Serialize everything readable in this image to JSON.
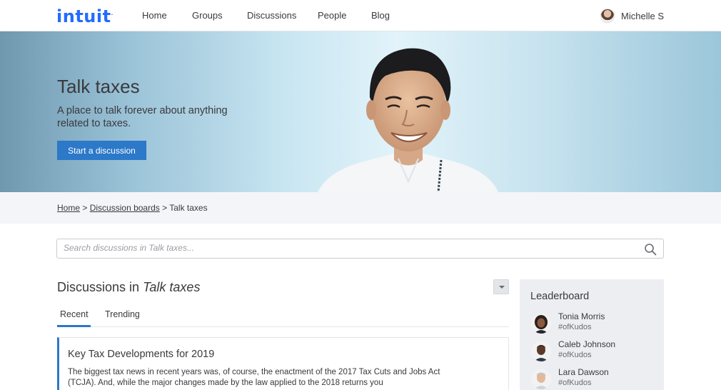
{
  "nav": {
    "logo": "intuit",
    "logo_mark": ".",
    "links": [
      "Home",
      "Groups",
      "Discussions",
      "People",
      "Blog"
    ],
    "user_name": "Michelle S"
  },
  "hero": {
    "title": "Talk taxes",
    "subtitle": "A place to talk forever about anything related to taxes.",
    "cta": "Start a discussion"
  },
  "breadcrumb": {
    "items": [
      "Home",
      "Discussion boards"
    ],
    "separator": ">",
    "current": "Talk taxes"
  },
  "search": {
    "placeholder": "Search discussions in Talk taxes...",
    "value": ""
  },
  "discussions": {
    "title_prefix": "Discussions in",
    "title_board": "Talk taxes",
    "tabs": [
      "Recent",
      "Trending"
    ],
    "active_tab": "Recent",
    "posts": [
      {
        "title": "Key Tax Developments for 2019",
        "excerpt": "The biggest tax news in recent years was, of course, the enactment of the 2017 Tax Cuts and Jobs Act (TCJA). And, while the major changes made by the law applied to the 2018 returns you"
      }
    ]
  },
  "leaderboard": {
    "title": "Leaderboard",
    "items": [
      {
        "name": "Tonia Morris",
        "tag": "#ofKudos"
      },
      {
        "name": "Caleb Johnson",
        "tag": "#ofKudos"
      },
      {
        "name": "Lara Dawson",
        "tag": "#ofKudos"
      }
    ]
  },
  "colors": {
    "brand": "#236cff",
    "accent": "#2c78c9",
    "text": "#393a3d"
  }
}
